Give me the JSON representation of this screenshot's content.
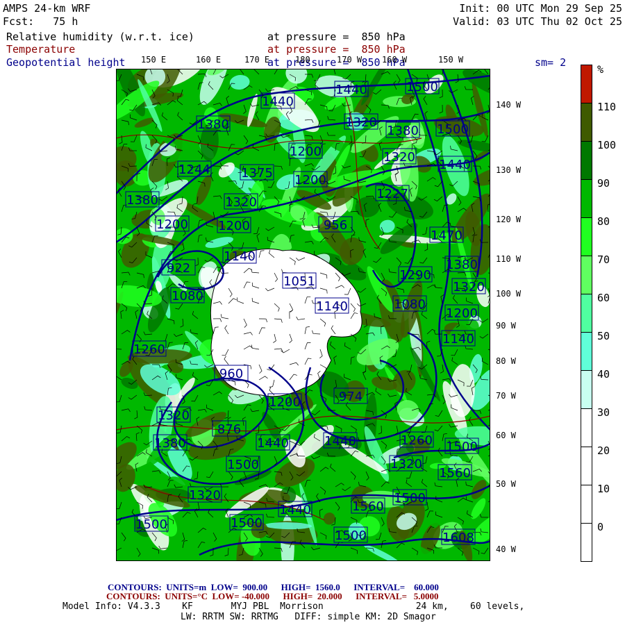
{
  "header": {
    "model": "AMPS 24-km WRF",
    "forecast": "Fcst:   75 h",
    "init": "Init: 00 UTC Mon 29 Sep 25",
    "valid": "Valid: 03 UTC Thu 02 Oct 25",
    "field1": "Relative humidity (w.r.t. ice)",
    "field1_level": "at pressure =  850 hPa",
    "field2": "Temperature",
    "field2_level": "at pressure =  850 hPa",
    "field3": "Geopotential height",
    "field3_level": "at pressure =  850 hPa",
    "smoothing": "sm= 2"
  },
  "map": {
    "top_lon_labels": [
      "150 E",
      "160 E",
      "170 E",
      "180",
      "170 W",
      "160 W",
      "150 W"
    ],
    "right_lon_labels": [
      "140 W",
      "130 W",
      "120 W",
      "110 W",
      "100 W",
      "90 W",
      "80 W",
      "70 W",
      "60 W",
      "50 W",
      "40 W"
    ],
    "height_contour_labels": [
      "1440",
      "1500",
      "1440",
      "1380",
      "1320",
      "1380",
      "1500",
      "1200",
      "1320",
      "1440",
      "1244",
      "1375",
      "1200",
      "1380",
      "1227",
      "1320",
      "1200",
      "1200",
      "956",
      "1470",
      "922",
      "1140",
      "1380",
      "1290",
      "1320",
      "1051",
      "1080",
      "1140",
      "1080",
      "1200",
      "1140",
      "1260",
      "960",
      "1200",
      "974",
      "1320",
      "876",
      "1380",
      "1440",
      "1440",
      "1260",
      "1500",
      "1500",
      "1320",
      "1560",
      "1320",
      "1560",
      "1500",
      "1440",
      "1500",
      "1500",
      "1500",
      "1608"
    ],
    "colors": {
      "height": "#00008b",
      "temperature": "#8b0000",
      "wind_barbs": "#000000",
      "land": "#ffffff"
    }
  },
  "colorbar": {
    "unit": "%",
    "labels": [
      "110",
      "100",
      "90",
      "80",
      "70",
      "60",
      "50",
      "40",
      "30",
      "20",
      "10",
      "0"
    ],
    "colors": [
      "#c01800",
      "#3f5a00",
      "#007800",
      "#00b800",
      "#20ff20",
      "#60ff60",
      "#50ffa0",
      "#60ffd8",
      "#c8fff0",
      "#ffffff",
      "#ffffff",
      "#ffffff",
      "#ffffff"
    ]
  },
  "footer": {
    "height_contours": "CONTOURS:  UNITS=m  LOW=  900.00      HIGH=  1560.0      INTERVAL=    60.000",
    "temp_contours": "CONTOURS:  UNITS=°C  LOW= -40.000      HIGH=  20.000      INTERVAL=   5.0000",
    "model_info": "Model Info: V4.3.3    KF       MYJ PBL  Morrison                 24 km,    60 levels,",
    "physics": "LW: RRTM SW: RRTMG   DIFF: simple KM: 2D Smagor"
  }
}
